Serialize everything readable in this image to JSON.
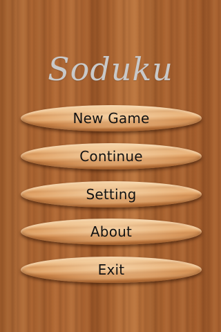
{
  "app": {
    "title": "Soduku"
  },
  "menu": {
    "items": [
      {
        "label": "New Game"
      },
      {
        "label": "Continue"
      },
      {
        "label": "Setting"
      },
      {
        "label": "About"
      },
      {
        "label": "Exit"
      }
    ]
  },
  "colors": {
    "background_wood": "#a8602c",
    "button_wood": "#e3a66a",
    "title_text": "#c9c9c9",
    "button_text": "#121212"
  }
}
